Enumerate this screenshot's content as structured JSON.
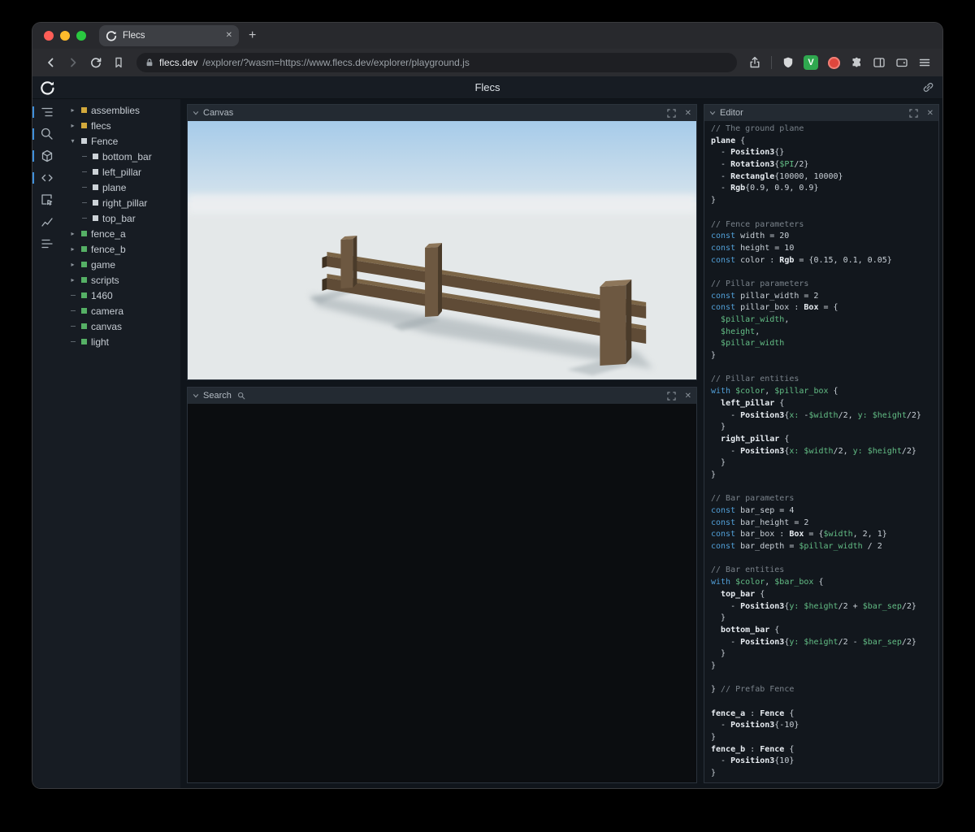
{
  "browser": {
    "tab_title": "Flecs",
    "url_domain": "flecs.dev",
    "url_path": "/explorer/?wasm=https://www.flecs.dev/explorer/playground.js",
    "v_badge": "V"
  },
  "app": {
    "title": "Flecs"
  },
  "panels": {
    "canvas_title": "Canvas",
    "search_title": "Search",
    "editor_title": "Editor"
  },
  "icons": {
    "close": "✕",
    "plus": "+",
    "chevron_right": "▸",
    "chevron_down": "▾"
  },
  "colors": {
    "yellow": "#d2a93c",
    "white": "#ccd2d7",
    "green": "#55b065",
    "accent": "#3f8fd9"
  },
  "sidebar": {
    "icons": [
      {
        "name": "outline-icon",
        "active": true
      },
      {
        "name": "search-icon",
        "active": true
      },
      {
        "name": "cube-icon",
        "active": true
      },
      {
        "name": "code-icon",
        "active": true
      },
      {
        "name": "inspect-icon",
        "active": false
      },
      {
        "name": "chart-icon",
        "active": false
      },
      {
        "name": "stats-icon",
        "active": false
      }
    ]
  },
  "tree": {
    "items": [
      {
        "label": "assemblies",
        "sq": "yellow",
        "mark": "right",
        "indent": 0
      },
      {
        "label": "flecs",
        "sq": "yellow",
        "mark": "right",
        "indent": 0
      },
      {
        "label": "Fence",
        "sq": "white",
        "mark": "down",
        "indent": 0
      },
      {
        "label": "bottom_bar",
        "sq": "white",
        "mark": "dash",
        "indent": 1
      },
      {
        "label": "left_pillar",
        "sq": "white",
        "mark": "dash",
        "indent": 1
      },
      {
        "label": "plane",
        "sq": "white",
        "mark": "dash",
        "indent": 1
      },
      {
        "label": "right_pillar",
        "sq": "white",
        "mark": "dash",
        "indent": 1
      },
      {
        "label": "top_bar",
        "sq": "white",
        "mark": "dash",
        "indent": 1
      },
      {
        "label": "fence_a",
        "sq": "green",
        "mark": "right",
        "indent": 0
      },
      {
        "label": "fence_b",
        "sq": "green",
        "mark": "right",
        "indent": 0
      },
      {
        "label": "game",
        "sq": "green",
        "mark": "right",
        "indent": 0
      },
      {
        "label": "scripts",
        "sq": "green",
        "mark": "right",
        "indent": 0
      },
      {
        "label": "1460",
        "sq": "green",
        "mark": "dash",
        "indent": 0
      },
      {
        "label": "camera",
        "sq": "green",
        "mark": "dash",
        "indent": 0
      },
      {
        "label": "canvas",
        "sq": "green",
        "mark": "dash",
        "indent": 0
      },
      {
        "label": "light",
        "sq": "green",
        "mark": "dash",
        "indent": 0
      }
    ]
  },
  "editor": {
    "lines": [
      [
        [
          "cm",
          "// The ground plane"
        ]
      ],
      [
        [
          "en",
          "plane"
        ],
        [
          "tx",
          " {"
        ]
      ],
      [
        [
          "tx",
          "  - "
        ],
        [
          "cp",
          "Position3"
        ],
        [
          "tx",
          "{}"
        ]
      ],
      [
        [
          "tx",
          "  - "
        ],
        [
          "cp",
          "Rotation3"
        ],
        [
          "tx",
          "{"
        ],
        [
          "vr",
          "$PI"
        ],
        [
          "tx",
          "/2}"
        ]
      ],
      [
        [
          "tx",
          "  - "
        ],
        [
          "cp",
          "Rectangle"
        ],
        [
          "tx",
          "{10000, 10000}"
        ]
      ],
      [
        [
          "tx",
          "  - "
        ],
        [
          "cp",
          "Rgb"
        ],
        [
          "tx",
          "{0.9, 0.9, 0.9}"
        ]
      ],
      [
        [
          "tx",
          "}"
        ]
      ],
      [],
      [
        [
          "cm",
          "// Fence parameters"
        ]
      ],
      [
        [
          "kw",
          "const "
        ],
        [
          "tx",
          "width = 20"
        ]
      ],
      [
        [
          "kw",
          "const "
        ],
        [
          "tx",
          "height = 10"
        ]
      ],
      [
        [
          "kw",
          "const "
        ],
        [
          "tx",
          "color : "
        ],
        [
          "cp",
          "Rgb"
        ],
        [
          "tx",
          " = {0.15, 0.1, 0.05}"
        ]
      ],
      [],
      [
        [
          "cm",
          "// Pillar parameters"
        ]
      ],
      [
        [
          "kw",
          "const "
        ],
        [
          "tx",
          "pillar_width = 2"
        ]
      ],
      [
        [
          "kw",
          "const "
        ],
        [
          "tx",
          "pillar_box : "
        ],
        [
          "cp",
          "Box"
        ],
        [
          "tx",
          " = {"
        ]
      ],
      [
        [
          "tx",
          "  "
        ],
        [
          "vr",
          "$pillar_width"
        ],
        [
          "tx",
          ","
        ]
      ],
      [
        [
          "tx",
          "  "
        ],
        [
          "vr",
          "$height"
        ],
        [
          "tx",
          ","
        ]
      ],
      [
        [
          "tx",
          "  "
        ],
        [
          "vr",
          "$pillar_width"
        ]
      ],
      [
        [
          "tx",
          "}"
        ]
      ],
      [],
      [
        [
          "cm",
          "// Pillar entities"
        ]
      ],
      [
        [
          "kw",
          "with "
        ],
        [
          "vr",
          "$color"
        ],
        [
          "tx",
          ", "
        ],
        [
          "vr",
          "$pillar_box"
        ],
        [
          "tx",
          " {"
        ]
      ],
      [
        [
          "tx",
          "  "
        ],
        [
          "en",
          "left_pillar"
        ],
        [
          "tx",
          " {"
        ]
      ],
      [
        [
          "tx",
          "    - "
        ],
        [
          "cp",
          "Position3"
        ],
        [
          "tx",
          "{"
        ],
        [
          "vr",
          "x:"
        ],
        [
          "tx",
          " -"
        ],
        [
          "vr",
          "$width"
        ],
        [
          "tx",
          "/2, "
        ],
        [
          "vr",
          "y:"
        ],
        [
          "tx",
          " "
        ],
        [
          "vr",
          "$height"
        ],
        [
          "tx",
          "/2}"
        ]
      ],
      [
        [
          "tx",
          "  }"
        ]
      ],
      [
        [
          "tx",
          "  "
        ],
        [
          "en",
          "right_pillar"
        ],
        [
          "tx",
          " {"
        ]
      ],
      [
        [
          "tx",
          "    - "
        ],
        [
          "cp",
          "Position3"
        ],
        [
          "tx",
          "{"
        ],
        [
          "vr",
          "x:"
        ],
        [
          "tx",
          " "
        ],
        [
          "vr",
          "$width"
        ],
        [
          "tx",
          "/2, "
        ],
        [
          "vr",
          "y:"
        ],
        [
          "tx",
          " "
        ],
        [
          "vr",
          "$height"
        ],
        [
          "tx",
          "/2}"
        ]
      ],
      [
        [
          "tx",
          "  }"
        ]
      ],
      [
        [
          "tx",
          "}"
        ]
      ],
      [],
      [
        [
          "cm",
          "// Bar parameters"
        ]
      ],
      [
        [
          "kw",
          "const "
        ],
        [
          "tx",
          "bar_sep = 4"
        ]
      ],
      [
        [
          "kw",
          "const "
        ],
        [
          "tx",
          "bar_height = 2"
        ]
      ],
      [
        [
          "kw",
          "const "
        ],
        [
          "tx",
          "bar_box : "
        ],
        [
          "cp",
          "Box"
        ],
        [
          "tx",
          " = {"
        ],
        [
          "vr",
          "$width"
        ],
        [
          "tx",
          ", 2, 1}"
        ]
      ],
      [
        [
          "kw",
          "const "
        ],
        [
          "tx",
          "bar_depth = "
        ],
        [
          "vr",
          "$pillar_width"
        ],
        [
          "tx",
          " / 2"
        ]
      ],
      [],
      [
        [
          "cm",
          "// Bar entities"
        ]
      ],
      [
        [
          "kw",
          "with "
        ],
        [
          "vr",
          "$color"
        ],
        [
          "tx",
          ", "
        ],
        [
          "vr",
          "$bar_box"
        ],
        [
          "tx",
          " {"
        ]
      ],
      [
        [
          "tx",
          "  "
        ],
        [
          "en",
          "top_bar"
        ],
        [
          "tx",
          " {"
        ]
      ],
      [
        [
          "tx",
          "    - "
        ],
        [
          "cp",
          "Position3"
        ],
        [
          "tx",
          "{"
        ],
        [
          "vr",
          "y:"
        ],
        [
          "tx",
          " "
        ],
        [
          "vr",
          "$height"
        ],
        [
          "tx",
          "/2 + "
        ],
        [
          "vr",
          "$bar_sep"
        ],
        [
          "tx",
          "/2}"
        ]
      ],
      [
        [
          "tx",
          "  }"
        ]
      ],
      [
        [
          "tx",
          "  "
        ],
        [
          "en",
          "bottom_bar"
        ],
        [
          "tx",
          " {"
        ]
      ],
      [
        [
          "tx",
          "    - "
        ],
        [
          "cp",
          "Position3"
        ],
        [
          "tx",
          "{"
        ],
        [
          "vr",
          "y:"
        ],
        [
          "tx",
          " "
        ],
        [
          "vr",
          "$height"
        ],
        [
          "tx",
          "/2 - "
        ],
        [
          "vr",
          "$bar_sep"
        ],
        [
          "tx",
          "/2}"
        ]
      ],
      [
        [
          "tx",
          "  }"
        ]
      ],
      [
        [
          "tx",
          "}"
        ]
      ],
      [],
      [
        [
          "tx",
          "} "
        ],
        [
          "cm",
          "// Prefab Fence"
        ]
      ],
      [],
      [
        [
          "en",
          "fence_a"
        ],
        [
          "tx",
          " : "
        ],
        [
          "cp",
          "Fence"
        ],
        [
          "tx",
          " {"
        ]
      ],
      [
        [
          "tx",
          "  - "
        ],
        [
          "cp",
          "Position3"
        ],
        [
          "tx",
          "{-10}"
        ]
      ],
      [
        [
          "tx",
          "}"
        ]
      ],
      [
        [
          "en",
          "fence_b"
        ],
        [
          "tx",
          " : "
        ],
        [
          "cp",
          "Fence"
        ],
        [
          "tx",
          " {"
        ]
      ],
      [
        [
          "tx",
          "  - "
        ],
        [
          "cp",
          "Position3"
        ],
        [
          "tx",
          "{10}"
        ]
      ],
      [
        [
          "tx",
          "}"
        ]
      ]
    ]
  }
}
